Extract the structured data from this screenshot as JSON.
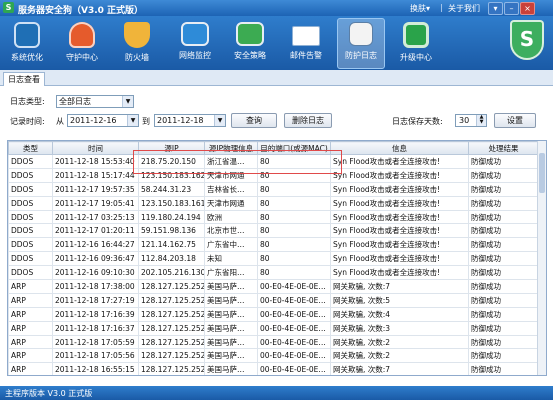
{
  "titlebar": {
    "logo": "S",
    "title": "服务器安全狗（V3.0 正式版）",
    "skin": "换肤▾",
    "about": "关于我们"
  },
  "toolbar": {
    "items": [
      {
        "label": "系统优化",
        "icon": "system-optimize-icon",
        "color": "#1f6fb5"
      },
      {
        "label": "守护中心",
        "icon": "guard-center-icon",
        "color": "#e55b2c"
      },
      {
        "label": "防火墙",
        "icon": "firewall-icon",
        "color": "#f0b43a"
      },
      {
        "label": "网络监控",
        "icon": "network-monitor-icon",
        "color": "#2e8bd8"
      },
      {
        "label": "安全策略",
        "icon": "security-policy-icon",
        "color": "#3cab52"
      },
      {
        "label": "邮件告警",
        "icon": "mail-alert-icon",
        "color": "#ffffff"
      },
      {
        "label": "防护日志",
        "icon": "protect-log-icon",
        "color": "#f3f3f3"
      },
      {
        "label": "升级中心",
        "icon": "upgrade-center-icon",
        "color": "#2aa34a"
      }
    ],
    "active_index": 6
  },
  "tabs": {
    "log_view": "日志查看"
  },
  "filter": {
    "log_type_label": "日志类型:",
    "log_type_value": "全部日志",
    "record_time_label": "记录时间:",
    "from_label": "从",
    "from_date": "2011-12-16",
    "to_label": "到",
    "to_date": "2011-12-18",
    "query_button": "查询",
    "delete_button": "删除日志",
    "keep_days_label": "日志保存天数:",
    "keep_days_value": "30",
    "settings_button": "设置"
  },
  "table": {
    "columns": [
      "类型",
      "时间",
      "源IP",
      "源IP物理信息",
      "目的端口(或源MAC)",
      "信息",
      "处理结果"
    ],
    "rows": [
      [
        "DDOS",
        "2011-12-18 15:53:40",
        "218.75.20.150",
        "浙江省温…",
        "80",
        "Syn Flood攻击或者全连接攻击!",
        "防御成功"
      ],
      [
        "DDOS",
        "2011-12-18 15:17:44",
        "123.150.183.162",
        "天津市网通",
        "80",
        "Syn Flood攻击或者全连接攻击!",
        "防御成功"
      ],
      [
        "DDOS",
        "2011-12-17 19:57:35",
        "58.244.31.23",
        "吉林省长…",
        "80",
        "Syn Flood攻击或者全连接攻击!",
        "防御成功"
      ],
      [
        "DDOS",
        "2011-12-17 19:05:41",
        "123.150.183.161",
        "天津市网通",
        "80",
        "Syn Flood攻击或者全连接攻击!",
        "防御成功"
      ],
      [
        "DDOS",
        "2011-12-17 03:25:13",
        "119.180.24.194",
        "欧洲",
        "80",
        "Syn Flood攻击或者全连接攻击!",
        "防御成功"
      ],
      [
        "DDOS",
        "2011-12-17 01:20:11",
        "59.151.98.136",
        "北京市世…",
        "80",
        "Syn Flood攻击或者全连接攻击!",
        "防御成功"
      ],
      [
        "DDOS",
        "2011-12-16 16:44:27",
        "121.14.162.75",
        "广东省中…",
        "80",
        "Syn Flood攻击或者全连接攻击!",
        "防御成功"
      ],
      [
        "DDOS",
        "2011-12-16 09:36:47",
        "112.84.203.18",
        "未知",
        "80",
        "Syn Flood攻击或者全连接攻击!",
        "防御成功"
      ],
      [
        "DDOS",
        "2011-12-16 09:10:30",
        "202.105.216.130",
        "广东省阳…",
        "80",
        "Syn Flood攻击或者全连接攻击!",
        "防御成功"
      ],
      [
        "ARP",
        "2011-12-18 17:38:00",
        "128.127.125.252",
        "美国马萨…",
        "00-E0-4E-0E-0E…",
        "网关欺骗, 次数:7",
        "防御成功"
      ],
      [
        "ARP",
        "2011-12-18 17:27:19",
        "128.127.125.252",
        "美国马萨…",
        "00-E0-4E-0E-0E…",
        "网关欺骗, 次数:5",
        "防御成功"
      ],
      [
        "ARP",
        "2011-12-18 17:16:39",
        "128.127.125.252",
        "美国马萨…",
        "00-E0-4E-0E-0E…",
        "网关欺骗, 次数:4",
        "防御成功"
      ],
      [
        "ARP",
        "2011-12-18 17:16:37",
        "128.127.125.252",
        "美国马萨…",
        "00-E0-4E-0E-0E…",
        "网关欺骗, 次数:3",
        "防御成功"
      ],
      [
        "ARP",
        "2011-12-18 17:05:59",
        "128.127.125.252",
        "美国马萨…",
        "00-E0-4E-0E-0E…",
        "网关欺骗, 次数:2",
        "防御成功"
      ],
      [
        "ARP",
        "2011-12-18 17:05:56",
        "128.127.125.252",
        "美国马萨…",
        "00-E0-4E-0E-0E…",
        "网关欺骗, 次数:2",
        "防御成功"
      ],
      [
        "ARP",
        "2011-12-18 16:55:15",
        "128.127.125.252",
        "美国马萨…",
        "00-E0-4E-0E-0E…",
        "网关欺骗, 次数:7",
        "防御成功"
      ]
    ]
  },
  "status": {
    "version": "主程序版本 V3.0 正式版"
  }
}
